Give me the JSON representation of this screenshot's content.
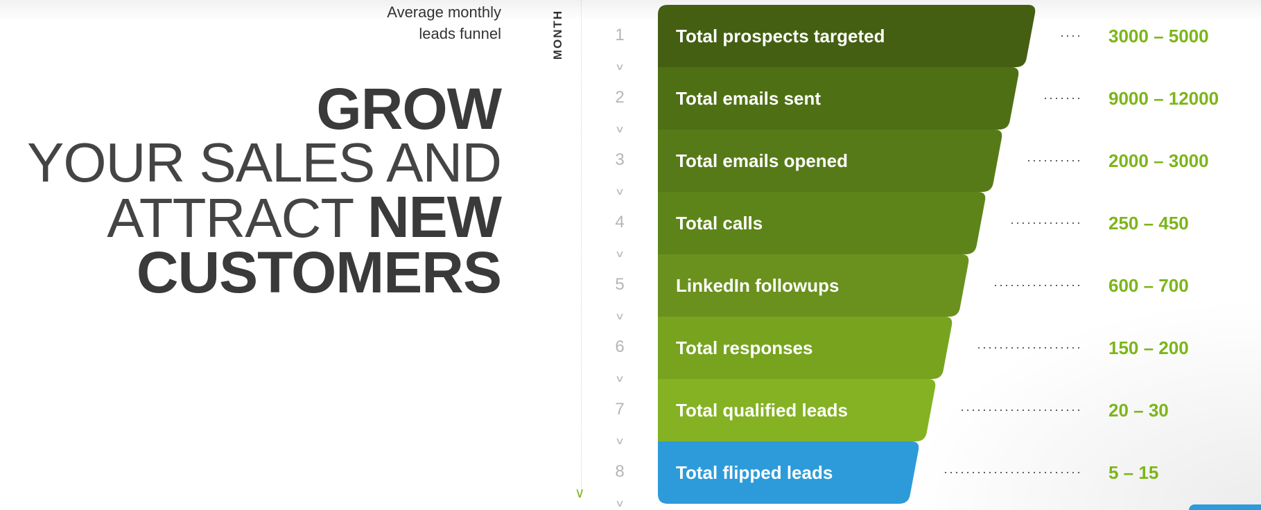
{
  "subtitle": {
    "line1": "Average monthly",
    "line2": "leads funnel"
  },
  "headline": {
    "line1": "GROW",
    "line2": "YOUR SALES AND",
    "line3_light": "ATTRACT ",
    "line3_bold": "NEW",
    "line4": "CUSTOMERS"
  },
  "axis_label": "MONTH",
  "funnel": [
    {
      "step": "1",
      "label": "Total prospects targeted",
      "value": "3000 – 5000",
      "color": "#445f12"
    },
    {
      "step": "2",
      "label": "Total emails sent",
      "value": "9000 – 12000",
      "color": "#4f6f15"
    },
    {
      "step": "3",
      "label": "Total emails opened",
      "value": "2000 – 3000",
      "color": "#577a18"
    },
    {
      "step": "4",
      "label": "Total calls",
      "value": "250 – 450",
      "color": "#5d8419"
    },
    {
      "step": "5",
      "label": "LinkedIn followups",
      "value": "600 – 700",
      "color": "#6a911d"
    },
    {
      "step": "6",
      "label": "Total responses",
      "value": "150 – 200",
      "color": "#77a31f"
    },
    {
      "step": "7",
      "label": "Total qualified leads",
      "value": "20 – 30",
      "color": "#84b223"
    },
    {
      "step": "8",
      "label": "Total flipped leads",
      "value": "5 – 15",
      "color": "#2d9bda"
    }
  ],
  "value_color": "#7cb518"
}
